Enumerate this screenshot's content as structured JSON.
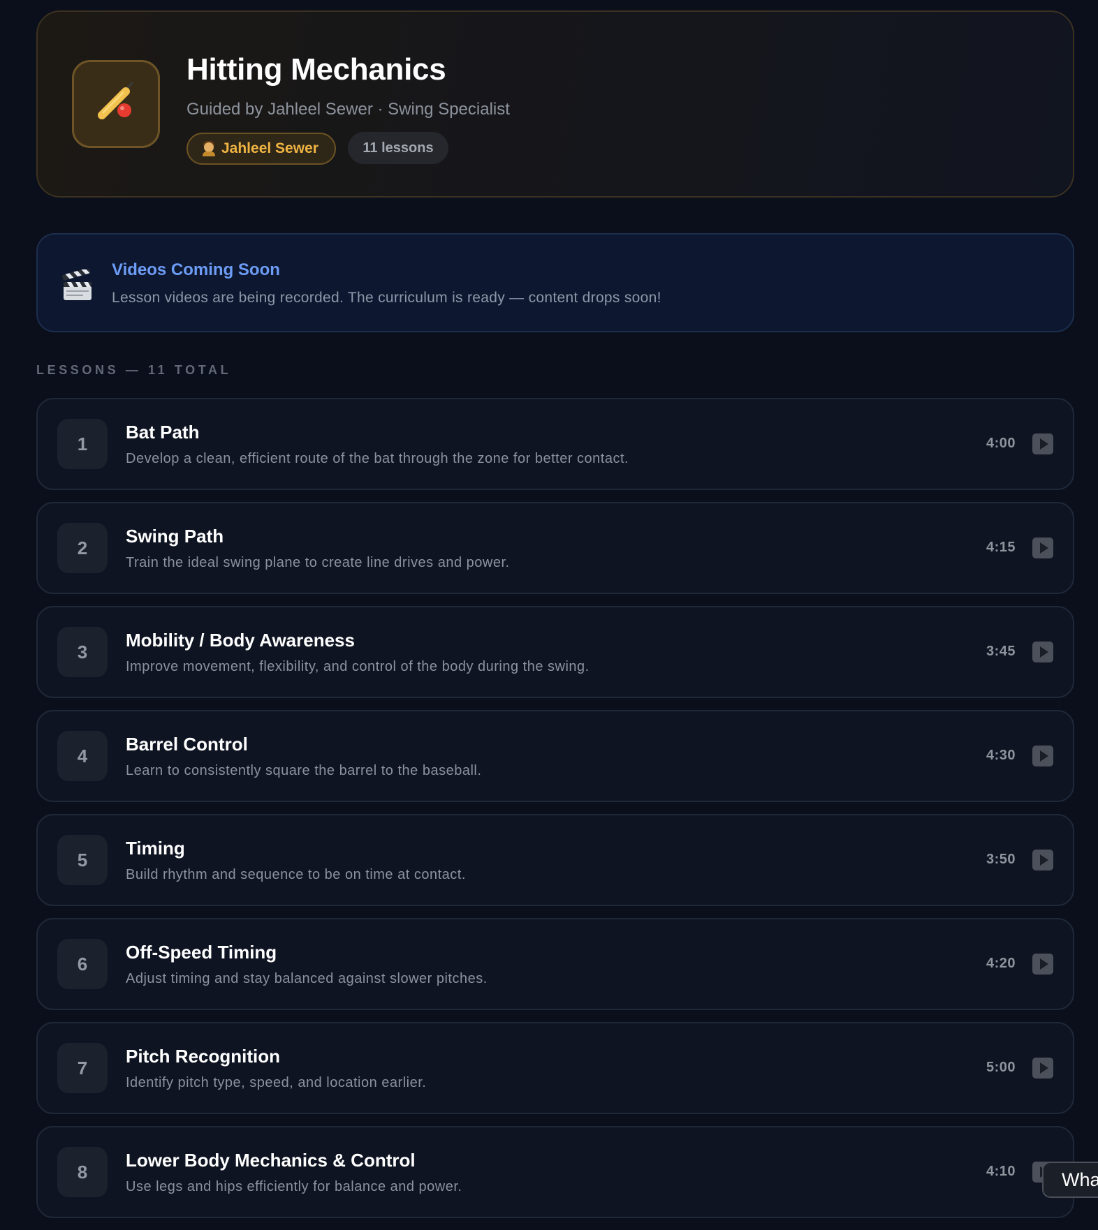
{
  "course": {
    "title": "Hitting Mechanics",
    "subtitle": "Guided by Jahleel Sewer · Swing Specialist",
    "icon": "baseball-bat-and-ball-icon",
    "coach_badge": "Jahleel Sewer",
    "lesson_count_badge": "11 lessons"
  },
  "notice": {
    "icon": "clapperboard-icon",
    "title": "Videos Coming Soon",
    "text": "Lesson videos are being recorded. The curriculum is ready — content drops soon!"
  },
  "lessons_section": {
    "label": "Lessons — 11 total"
  },
  "lessons": [
    {
      "number": "1",
      "title": "Bat Path",
      "description": "Develop a clean, efficient route of the bat through the zone for better contact.",
      "duration": "4:00"
    },
    {
      "number": "2",
      "title": "Swing Path",
      "description": "Train the ideal swing plane to create line drives and power.",
      "duration": "4:15"
    },
    {
      "number": "3",
      "title": "Mobility / Body Awareness",
      "description": "Improve movement, flexibility, and control of the body during the swing.",
      "duration": "3:45"
    },
    {
      "number": "4",
      "title": "Barrel Control",
      "description": "Learn to consistently square the barrel to the baseball.",
      "duration": "4:30"
    },
    {
      "number": "5",
      "title": "Timing",
      "description": "Build rhythm and sequence to be on time at contact.",
      "duration": "3:50"
    },
    {
      "number": "6",
      "title": "Off-Speed Timing",
      "description": "Adjust timing and stay balanced against slower pitches.",
      "duration": "4:20"
    },
    {
      "number": "7",
      "title": "Pitch Recognition",
      "description": "Identify pitch type, speed, and location earlier.",
      "duration": "5:00"
    },
    {
      "number": "8",
      "title": "Lower Body Mechanics & Control",
      "description": "Use legs and hips efficiently for balance and power.",
      "duration": "4:10"
    }
  ],
  "chat": {
    "label": "Wha"
  },
  "colors": {
    "page_background": "#0a0f1b",
    "accent_gold": "#f0b443",
    "notice_blue": "#6d9cf6"
  }
}
